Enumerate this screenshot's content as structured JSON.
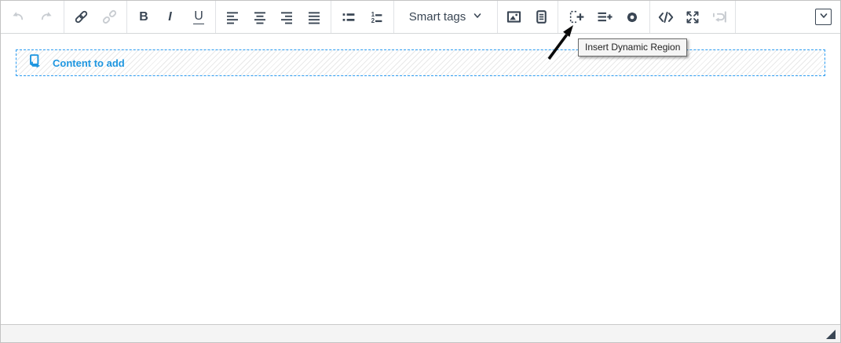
{
  "editor": {
    "kind": "rich-text-editor",
    "toolbar": {
      "labels": {
        "bold": "B",
        "italic": "I",
        "underline": "U",
        "smart_tags": "Smart tags"
      },
      "groups": [
        {
          "name": "history",
          "items": [
            {
              "icon": "undo-icon",
              "disabled": true
            },
            {
              "icon": "redo-icon",
              "disabled": true
            }
          ]
        },
        {
          "name": "links",
          "items": [
            {
              "icon": "link-icon",
              "disabled": false
            },
            {
              "icon": "unlink-icon",
              "disabled": true
            }
          ]
        },
        {
          "name": "text-style",
          "items": [
            {
              "label": "B"
            },
            {
              "label": "I"
            },
            {
              "label": "U"
            }
          ]
        },
        {
          "name": "alignment",
          "items": [
            {
              "icon": "align-left-icon"
            },
            {
              "icon": "align-center-icon"
            },
            {
              "icon": "align-right-icon"
            },
            {
              "icon": "align-justify-icon"
            }
          ]
        },
        {
          "name": "lists",
          "items": [
            {
              "icon": "bullet-list-icon"
            },
            {
              "icon": "numbered-list-icon"
            }
          ]
        },
        {
          "name": "smart-tags",
          "items": [
            {
              "label": "Smart tags",
              "icon": "chevron-down-icon"
            }
          ]
        },
        {
          "name": "media",
          "items": [
            {
              "icon": "image-icon"
            },
            {
              "icon": "document-icon"
            }
          ]
        },
        {
          "name": "dynamic",
          "items": [
            {
              "icon": "insert-dynamic-region-icon"
            },
            {
              "icon": "insert-list-icon"
            },
            {
              "icon": "settings-gear-icon"
            }
          ]
        },
        {
          "name": "view",
          "items": [
            {
              "icon": "source-code-icon"
            },
            {
              "icon": "fullscreen-icon"
            },
            {
              "icon": "repeat-icon",
              "disabled": true
            }
          ]
        },
        {
          "name": "overflow",
          "items": [
            {
              "icon": "toolbar-collapse-icon"
            }
          ]
        }
      ]
    },
    "tooltip": {
      "text": "Insert Dynamic Region",
      "target": "insert-dynamic-region-button"
    },
    "content": {
      "placeholder_label": "Content to add",
      "placeholder_icon": "content-page-arrow-icon"
    },
    "statusbar": {
      "resize_handle_icon": "resize-triangle"
    }
  },
  "colors": {
    "accent_blue": "#2b9cf2",
    "placeholder_text": "#1e96e0",
    "icon": "#3a4654",
    "icon_disabled": "#c8ccd1",
    "separator": "#e0e2e5",
    "toolbar_border": "#d5d7d9",
    "outer_border": "#c3c3c3",
    "statusbar_bg": "#f4f4f4",
    "statusbar_border": "#c9c9c9",
    "tooltip_bg": "#f5f5f5",
    "tooltip_border": "#6a6a6a",
    "tooltip_text": "#222222",
    "hatch": "#e9e9e9"
  }
}
